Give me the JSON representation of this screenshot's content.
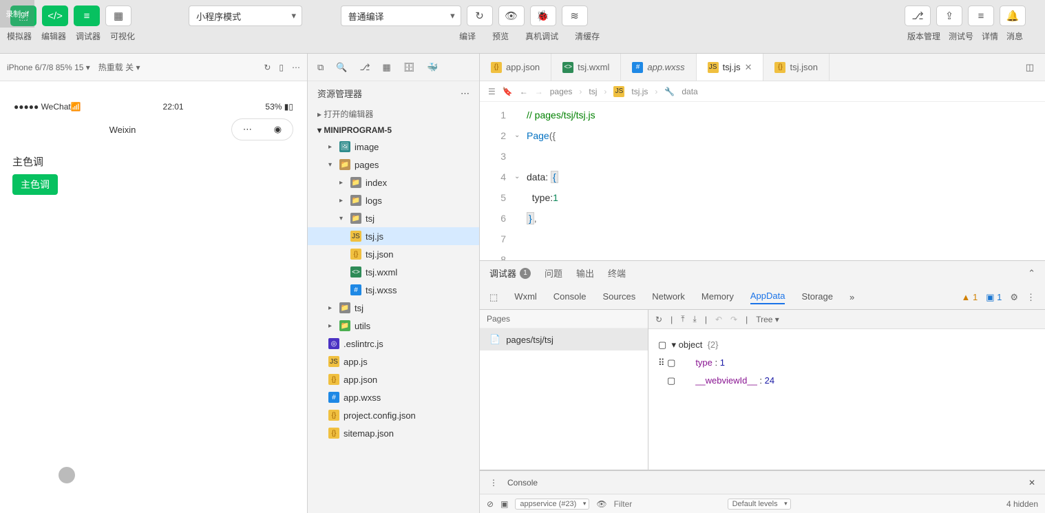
{
  "gifBadge": "录制gif",
  "toolbar": {
    "labels": {
      "sim": "模拟器",
      "editor": "编辑器",
      "debug": "调试器",
      "compvis": "可视化"
    },
    "mode": "小程序模式",
    "compile": "普通编译",
    "sub": {
      "compile": "编译",
      "preview": "预览",
      "remotedebug": "真机调试",
      "clearcache": "清缓存"
    },
    "right": {
      "version": "版本管理",
      "testacc": "测试号",
      "details": "详情",
      "msg": "消息"
    }
  },
  "sim": {
    "device": "iPhone 6/7/8 85% 15",
    "hotreload": "热重载 关",
    "status": {
      "carrier": "●●●●● WeChat",
      "time": "22:01",
      "battery": "53%"
    },
    "title": "Weixin",
    "content": {
      "label": "主色调",
      "button": "主色调"
    }
  },
  "explorer": {
    "title": "资源管理器",
    "openEditors": "打开的编辑器",
    "project": "MINIPROGRAM-5",
    "tree": {
      "image": "image",
      "pages": "pages",
      "index": "index",
      "logs": "logs",
      "tsj": "tsj",
      "tsjjs": "tsj.js",
      "tsjjson": "tsj.json",
      "tsjwxml": "tsj.wxml",
      "tsjwxss": "tsj.wxss",
      "tsj2": "tsj",
      "utils": "utils",
      "eslint": ".eslintrc.js",
      "appjs": "app.js",
      "appjson": "app.json",
      "appwxss": "app.wxss",
      "projcfg": "project.config.json",
      "sitemap": "sitemap.json"
    }
  },
  "tabs": {
    "appjson": "app.json",
    "tsjwxml": "tsj.wxml",
    "appwxss": "app.wxss",
    "tsjjs": "tsj.js",
    "tsjjson": "tsj.json"
  },
  "breadcrumb": {
    "p1": "pages",
    "p2": "tsj",
    "p3": "tsj.js",
    "p4": "data"
  },
  "code": {
    "l1": "// pages/tsj/tsj.js",
    "l2a": "Page",
    "l2b": "({",
    "l4a": "data:",
    "l4b": "{",
    "l5a": "type:",
    "l5b": "1",
    "l6": "},"
  },
  "panel": {
    "debugger": "调试器",
    "badge": "1",
    "problems": "问题",
    "output": "输出",
    "terminal": "终端",
    "wxml": "Wxml",
    "console": "Console",
    "sources": "Sources",
    "network": "Network",
    "memory": "Memory",
    "appdata": "AppData",
    "storage": "Storage",
    "warnCount": "1",
    "infoCount": "1"
  },
  "pagesPanel": {
    "header": "Pages",
    "item": "pages/tsj/tsj"
  },
  "appdata": {
    "treeLabel": "Tree",
    "obj": "object",
    "objMeta": "{2}",
    "k1": "type",
    "v1": "1",
    "k2": "__webviewId__",
    "v2": "24"
  },
  "consoleDrawer": {
    "title": "Console"
  },
  "consoleBar": {
    "ctx": "appservice (#23)",
    "filter": "Filter",
    "levels": "Default levels",
    "hidden": "4 hidden"
  }
}
